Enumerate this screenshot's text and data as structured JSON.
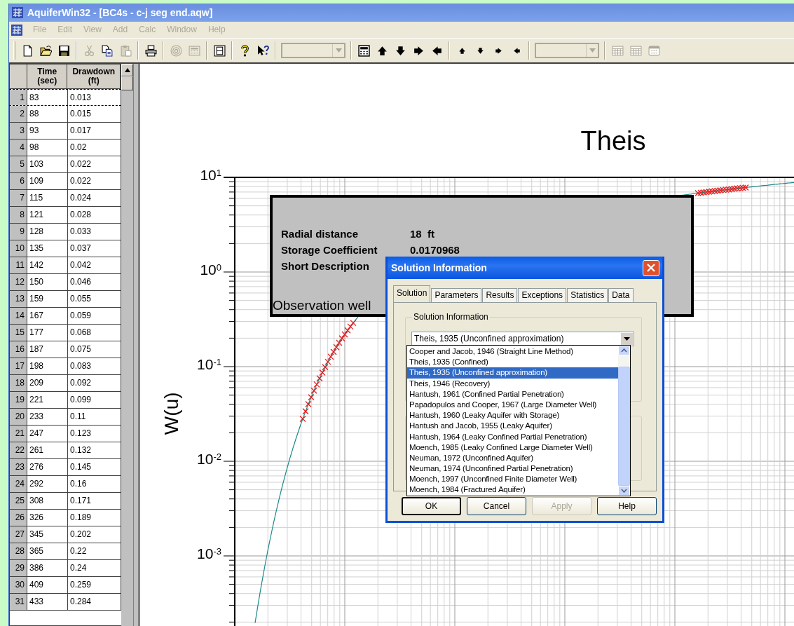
{
  "window": {
    "title": "AquiferWin32 - [BC4s - c-j seg end.aqw]"
  },
  "menu": [
    {
      "label": "File",
      "disabled": true
    },
    {
      "label": "Edit",
      "disabled": true
    },
    {
      "label": "View",
      "disabled": true
    },
    {
      "label": "Add",
      "disabled": true
    },
    {
      "label": "Calc",
      "disabled": true
    },
    {
      "label": "Window",
      "disabled": true
    },
    {
      "label": "Help",
      "disabled": true
    }
  ],
  "toolbar": [
    {
      "kind": "new",
      "disabled": false
    },
    {
      "kind": "open",
      "disabled": false
    },
    {
      "kind": "save",
      "disabled": false
    },
    {
      "kind": "separator"
    },
    {
      "kind": "cut",
      "disabled": true
    },
    {
      "kind": "copy",
      "disabled": false
    },
    {
      "kind": "paste",
      "disabled": true
    },
    {
      "kind": "separator"
    },
    {
      "kind": "print",
      "disabled": false
    },
    {
      "kind": "separator"
    },
    {
      "kind": "target",
      "disabled": true
    },
    {
      "kind": "calc",
      "disabled": true
    },
    {
      "kind": "separator"
    },
    {
      "kind": "frame",
      "disabled": false
    },
    {
      "kind": "separator"
    },
    {
      "kind": "help",
      "disabled": false
    },
    {
      "kind": "context_help",
      "disabled": false
    },
    {
      "kind": "separator"
    },
    {
      "kind": "combo",
      "disabled": true
    },
    {
      "kind": "separator"
    },
    {
      "kind": "calculator",
      "disabled": false
    },
    {
      "kind": "up",
      "disabled": false
    },
    {
      "kind": "down",
      "disabled": false
    },
    {
      "kind": "right",
      "disabled": false
    },
    {
      "kind": "left",
      "disabled": false
    },
    {
      "kind": "separator"
    },
    {
      "kind": "small_up",
      "disabled": false
    },
    {
      "kind": "small_down",
      "disabled": false
    },
    {
      "kind": "small_right",
      "disabled": false
    },
    {
      "kind": "small_left",
      "disabled": false
    },
    {
      "kind": "separator"
    },
    {
      "kind": "combo",
      "disabled": true
    },
    {
      "kind": "separator"
    },
    {
      "kind": "grid",
      "disabled": true
    },
    {
      "kind": "grid",
      "disabled": true
    },
    {
      "kind": "grid_window",
      "disabled": true
    }
  ],
  "table": {
    "columns": [
      {
        "title": "Time",
        "unit": "(sec)"
      },
      {
        "title": "Drawdown",
        "unit": "(ft)"
      }
    ],
    "rows": [
      {
        "number": "1",
        "time": "83",
        "drawdown": "0.013",
        "selected": true
      },
      {
        "number": "2",
        "time": "88",
        "drawdown": "0.015",
        "selected": false
      },
      {
        "number": "3",
        "time": "93",
        "drawdown": "0.017",
        "selected": false
      },
      {
        "number": "4",
        "time": "98",
        "drawdown": "0.02",
        "selected": false
      },
      {
        "number": "5",
        "time": "103",
        "drawdown": "0.022",
        "selected": false
      },
      {
        "number": "6",
        "time": "109",
        "drawdown": "0.022",
        "selected": false
      },
      {
        "number": "7",
        "time": "115",
        "drawdown": "0.024",
        "selected": false
      },
      {
        "number": "8",
        "time": "121",
        "drawdown": "0.028",
        "selected": false
      },
      {
        "number": "9",
        "time": "128",
        "drawdown": "0.033",
        "selected": false
      },
      {
        "number": "10",
        "time": "135",
        "drawdown": "0.037",
        "selected": false
      },
      {
        "number": "11",
        "time": "142",
        "drawdown": "0.042",
        "selected": false
      },
      {
        "number": "12",
        "time": "150",
        "drawdown": "0.046",
        "selected": false
      },
      {
        "number": "13",
        "time": "159",
        "drawdown": "0.055",
        "selected": false
      },
      {
        "number": "14",
        "time": "167",
        "drawdown": "0.059",
        "selected": false
      },
      {
        "number": "15",
        "time": "177",
        "drawdown": "0.068",
        "selected": false
      },
      {
        "number": "16",
        "time": "187",
        "drawdown": "0.075",
        "selected": false
      },
      {
        "number": "17",
        "time": "198",
        "drawdown": "0.083",
        "selected": false
      },
      {
        "number": "18",
        "time": "209",
        "drawdown": "0.092",
        "selected": false
      },
      {
        "number": "19",
        "time": "221",
        "drawdown": "0.099",
        "selected": false
      },
      {
        "number": "20",
        "time": "233",
        "drawdown": "0.11",
        "selected": false
      },
      {
        "number": "21",
        "time": "247",
        "drawdown": "0.123",
        "selected": false
      },
      {
        "number": "22",
        "time": "261",
        "drawdown": "0.132",
        "selected": false
      },
      {
        "number": "23",
        "time": "276",
        "drawdown": "0.145",
        "selected": false
      },
      {
        "number": "24",
        "time": "292",
        "drawdown": "0.16",
        "selected": false
      },
      {
        "number": "25",
        "time": "308",
        "drawdown": "0.171",
        "selected": false
      },
      {
        "number": "26",
        "time": "326",
        "drawdown": "0.189",
        "selected": false
      },
      {
        "number": "27",
        "time": "345",
        "drawdown": "0.202",
        "selected": false
      },
      {
        "number": "28",
        "time": "365",
        "drawdown": "0.22",
        "selected": false
      },
      {
        "number": "29",
        "time": "386",
        "drawdown": "0.24",
        "selected": false
      },
      {
        "number": "30",
        "time": "409",
        "drawdown": "0.259",
        "selected": false
      },
      {
        "number": "31",
        "time": "433",
        "drawdown": "0.284",
        "selected": false
      }
    ]
  },
  "plot": {
    "title": "Theis",
    "ylabel": "W(u)",
    "yticks": [
      "10$^{1}$",
      "10$^{0}$",
      "10$^{-1}$",
      "10$^{-2}$",
      "10$^{-3}$"
    ]
  },
  "info_box": {
    "fields": [
      {
        "label": "Radial distance",
        "value": "18  ft"
      },
      {
        "label": "Storage Coefficient",
        "value": "0.0170968"
      },
      {
        "label": "Short Description"
      }
    ],
    "caption": "Observation well"
  },
  "dialog": {
    "title": "Solution Information",
    "tabs": [
      {
        "label": "Solution",
        "selected": true
      },
      {
        "label": "Parameters",
        "selected": false
      },
      {
        "label": "Results",
        "selected": false
      },
      {
        "label": "Exceptions",
        "selected": false
      },
      {
        "label": "Statistics",
        "selected": false
      },
      {
        "label": "Data",
        "selected": false
      }
    ],
    "group_label": "Solution Information",
    "combo_value": "Theis, 1935 (Unconfined approximation)",
    "options": [
      {
        "label": "Cooper and Jacob, 1946 (Straight Line Method)",
        "selected": false
      },
      {
        "label": "Theis, 1935 (Confined)",
        "selected": false
      },
      {
        "label": "Theis, 1935 (Unconfined approximation)",
        "selected": true
      },
      {
        "label": "Theis, 1946 (Recovery)",
        "selected": false
      },
      {
        "label": "Hantush, 1961 (Confined Partial Penetration)",
        "selected": false
      },
      {
        "label": "Papadopulos and Cooper, 1967 (Large Diameter Well)",
        "selected": false
      },
      {
        "label": "Hantush, 1960 (Leaky Aquifer with Storage)",
        "selected": false
      },
      {
        "label": "Hantush and Jacob, 1955 (Leaky Aquifer)",
        "selected": false
      },
      {
        "label": "Hantush, 1964 (Leaky Confined Partial Penetration)",
        "selected": false
      },
      {
        "label": "Moench, 1985 (Leaky Confined Large Diameter Well)",
        "selected": false
      },
      {
        "label": "Neuman, 1972 (Unconfined Aquifer)",
        "selected": false
      },
      {
        "label": "Neuman, 1974 (Unconfined Partial Penetration)",
        "selected": false
      },
      {
        "label": "Moench, 1997 (Unconfined Finite Diameter Well)",
        "selected": false
      },
      {
        "label": "Moench, 1984 (Fractured Aquifer)",
        "selected": false
      }
    ],
    "buttons": [
      {
        "label": "OK",
        "default": true,
        "disabled": false
      },
      {
        "label": "Cancel",
        "default": false,
        "disabled": false
      },
      {
        "label": "Apply",
        "default": false,
        "disabled": true
      },
      {
        "label": "Help",
        "default": false,
        "disabled": false
      }
    ]
  }
}
